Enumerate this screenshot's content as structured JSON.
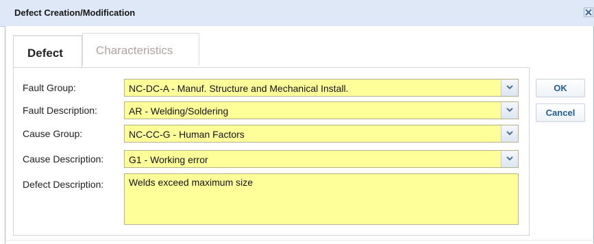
{
  "dialog": {
    "title": "Defect Creation/Modification"
  },
  "tabs": [
    {
      "label": "Defect",
      "active": true
    },
    {
      "label": "Characteristics",
      "active": false
    }
  ],
  "form": {
    "fault_group": {
      "label": "Fault Group:",
      "value": "NC-DC-A - Manuf. Structure and Mechanical Install."
    },
    "fault_description": {
      "label": "Fault Description:",
      "value": "AR - Welding/Soldering"
    },
    "cause_group": {
      "label": "Cause Group:",
      "value": "NC-CC-G - Human Factors"
    },
    "cause_description": {
      "label": "Cause Description:",
      "value": "G1 - Working error"
    },
    "defect_description": {
      "label": "Defect Description:",
      "value": "Welds exceed maximum size"
    }
  },
  "buttons": {
    "ok": "OK",
    "cancel": "Cancel"
  },
  "colors": {
    "field_background": "#ffff99",
    "titlebar_background": "#dfe8f6",
    "button_text": "#1f5b9a"
  },
  "icons": {
    "close": "close-icon",
    "dropdown": "chevron-down-icon"
  }
}
